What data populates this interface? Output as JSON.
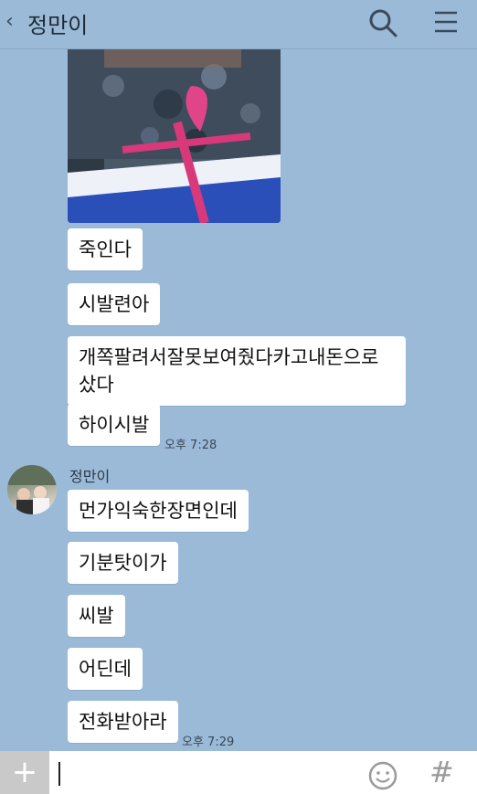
{
  "header": {
    "title": "정만이",
    "back_icon": "chevron-left-icon",
    "search_icon": "search-icon",
    "menu_icon": "hamburger-menu-icon"
  },
  "messages_block1": [
    "죽인다",
    "시발련아",
    "개쪽팔려서잘못보여줬다카고내돈으로샀다",
    "하이시발"
  ],
  "time1": "오후 7:28",
  "sender": "정만이",
  "messages_block2": [
    "먼가익숙한장면인데",
    "기분탓이가",
    "씨발",
    "어딘데",
    "전화받아라"
  ],
  "time2": "오후 7:29",
  "input": {
    "plus_icon": "plus-icon",
    "emoji_icon": "smiley-icon",
    "hash_icon": "hash-icon",
    "hash_label": "#"
  }
}
